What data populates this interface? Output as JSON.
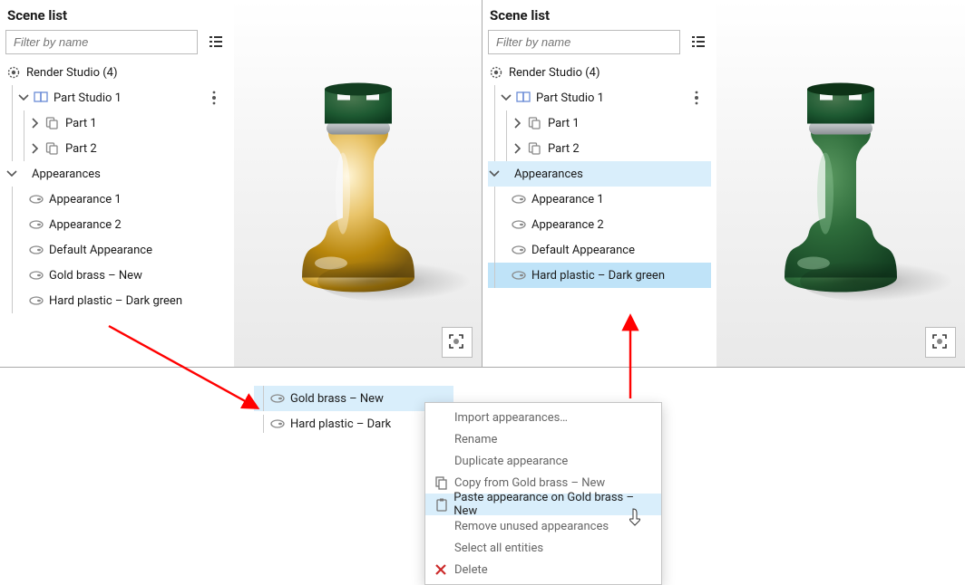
{
  "left": {
    "title": "Scene list",
    "filterPlaceholder": "Filter by name",
    "root": "Render Studio (4)",
    "studio": "Part Studio 1",
    "part1": "Part 1",
    "part2": "Part 2",
    "appearances": "Appearances",
    "ap1": "Appearance 1",
    "ap2": "Appearance 2",
    "apDef": "Default Appearance",
    "apGold": "Gold brass – New",
    "apDark": "Hard plastic – Dark green"
  },
  "right": {
    "title": "Scene list",
    "filterPlaceholder": "Filter by name",
    "root": "Render Studio (4)",
    "studio": "Part Studio 1",
    "part1": "Part 1",
    "part2": "Part 2",
    "appearances": "Appearances",
    "ap1": "Appearance 1",
    "ap2": "Appearance 2",
    "apDef": "Default Appearance",
    "apDark": "Hard plastic – Dark green"
  },
  "float": {
    "gold": "Gold brass – New",
    "dark": "Hard plastic – Dark"
  },
  "ctx": {
    "import": "Import appearances…",
    "rename": "Rename",
    "dup": "Duplicate appearance",
    "copy": "Copy from Gold brass – New",
    "paste": "Paste appearance on Gold brass – New",
    "remove": "Remove unused appearances",
    "selectAll": "Select all entities",
    "delete": "Delete"
  }
}
